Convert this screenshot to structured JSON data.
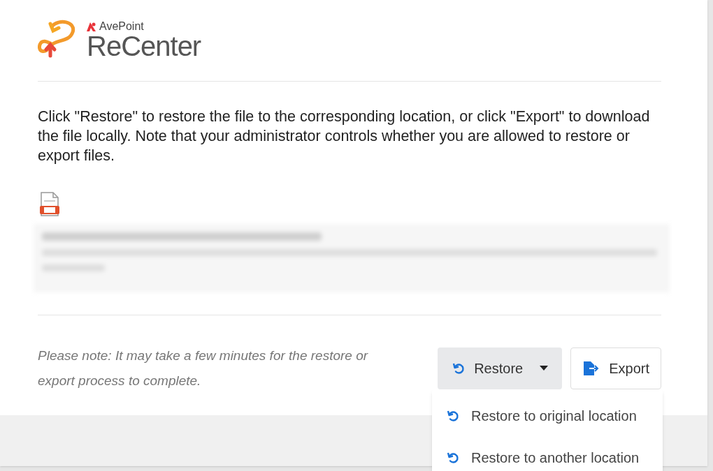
{
  "logo": {
    "brand": "AvePoint",
    "product": "ReCenter"
  },
  "message": "Click \"Restore\" to restore the file to the corresponding location, or click \"Export\" to download the file locally. Note that your administrator controls whether you are allowed to restore or export files.",
  "note": "Please note: It may take a few minutes for the restore or export process to complete.",
  "buttons": [
    {
      "kind": "dropdown",
      "label": "Restore",
      "expanded": true
    },
    {
      "kind": "export",
      "label": "Export"
    }
  ],
  "menu": [
    {
      "label": "Restore to original location"
    },
    {
      "label": "Restore to another location"
    }
  ]
}
